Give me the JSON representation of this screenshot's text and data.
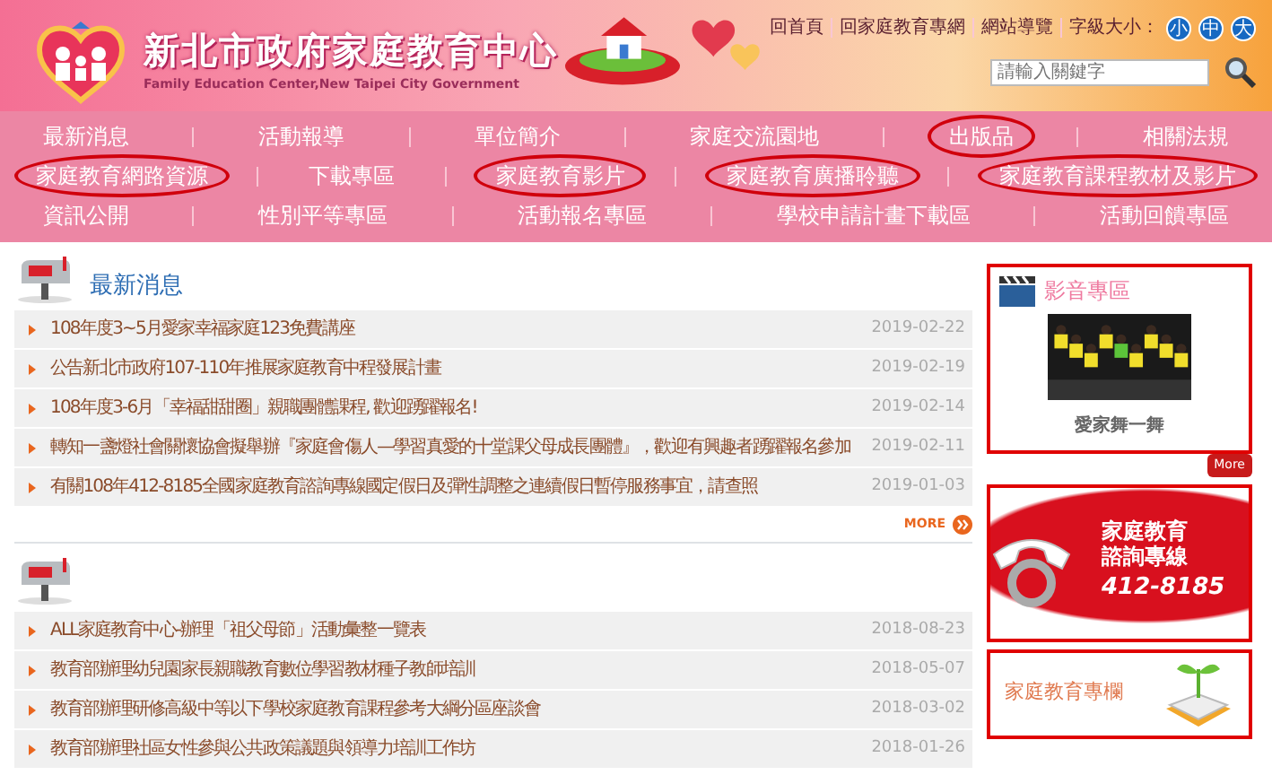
{
  "header": {
    "title": "新北市政府家庭教育中心",
    "subtitle": "Family Education Center,New Taipei City Government",
    "top_links": [
      "回首頁",
      "回家庭教育專網",
      "網站導覽"
    ],
    "font_size_label": "字級大小：",
    "font_sizes": [
      "小",
      "中",
      "大"
    ],
    "search": {
      "placeholder": "請輸入關鍵字"
    }
  },
  "nav": [
    [
      {
        "label": "最新消息",
        "highlighted": false
      },
      {
        "label": "活動報導",
        "highlighted": false
      },
      {
        "label": "單位簡介",
        "highlighted": false
      },
      {
        "label": "家庭交流園地",
        "highlighted": false
      },
      {
        "label": "出版品",
        "highlighted": true
      },
      {
        "label": "相關法規",
        "highlighted": false
      }
    ],
    [
      {
        "label": "家庭教育網路資源",
        "highlighted": true
      },
      {
        "label": "下載專區",
        "highlighted": false
      },
      {
        "label": "家庭教育影片",
        "highlighted": true
      },
      {
        "label": "家庭教育廣播聆聽",
        "highlighted": true
      },
      {
        "label": "家庭教育課程教材及影片",
        "highlighted": true
      }
    ],
    [
      {
        "label": "資訊公開",
        "highlighted": false
      },
      {
        "label": "性別平等專區",
        "highlighted": false
      },
      {
        "label": "活動報名專區",
        "highlighted": false
      },
      {
        "label": "學校申請計畫下載區",
        "highlighted": false
      },
      {
        "label": "活動回饋專區",
        "highlighted": false
      }
    ]
  ],
  "news_sections": [
    {
      "title": "最新消息",
      "items": [
        {
          "title": "108年度3~5月愛家幸福家庭123免費講座",
          "date": "2019-02-22"
        },
        {
          "title": "公告新北市政府107-110年推展家庭教育中程發展計畫",
          "date": "2019-02-19"
        },
        {
          "title": "108年度3-6月「幸福甜甜圈」親職團體課程, 歡迎踴躍報名!",
          "date": "2019-02-14"
        },
        {
          "title": "轉知一盞燈社會關懷協會擬舉辦『家庭會傷人—學習真愛的十堂課父母成長團體』，歡迎有興趣者踴躍報名參加",
          "date": "2019-02-11"
        },
        {
          "title": "有關108年412-8185全國家庭教育諮詢專線國定假日及彈性調整之連續假日暫停服務事宜，請查照",
          "date": "2019-01-03"
        }
      ],
      "more": "MORE"
    },
    {
      "items": [
        {
          "title": "ALL家庭教育中心-辦理「祖父母節」活動彙整一覽表",
          "date": "2018-08-23"
        },
        {
          "title": "教育部辦理幼兒園家長親職教育數位學習教材種子教師培訓",
          "date": "2018-05-07"
        },
        {
          "title": "教育部辦理研修高級中等以下學校家庭教育課程參考大綱分區座談會",
          "date": "2018-03-02"
        },
        {
          "title": "教育部辦理社區女性參與公共政策議題與領導力培訓工作坊",
          "date": "2018-01-26"
        }
      ]
    }
  ],
  "sidebar": {
    "video": {
      "title": "影音專區",
      "caption": "愛家舞一舞",
      "more": "More",
      "highlighted": true
    },
    "hotline": {
      "lines": [
        "家庭教育",
        "諮詢專線"
      ],
      "number": "412-8185",
      "highlighted": true
    },
    "column": {
      "title": "家庭教育專欄",
      "highlighted": true
    }
  }
}
